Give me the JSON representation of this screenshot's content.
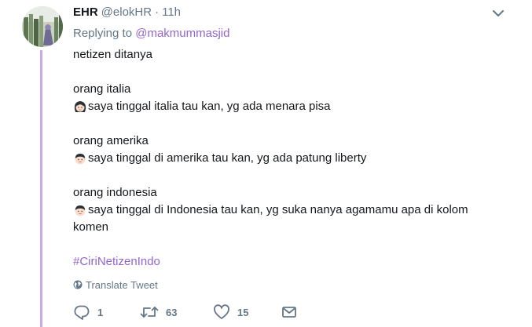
{
  "tweet": {
    "author_name": "EHR",
    "author_handle": "@elokHR",
    "separator": "·",
    "time": "11h",
    "replying_prefix": "Replying to",
    "replying_to": "@makmummasjid",
    "lines": {
      "l1": "netizen ditanya",
      "l2": "orang italia",
      "l3": "saya tinggal italia tau kan, yg ada menara pisa",
      "l4": "orang amerika",
      "l5": "saya tinggal di amerika tau kan, yg ada patung liberty",
      "l6": "orang indonesia",
      "l7": "saya tinggal di Indonesia tau kan, yg suka nanya agamamu apa di kolom",
      "l8": "komen"
    },
    "hashtag": "#CiriNetizenIndo",
    "emojis": [
      "woman-face-emoji",
      "boy-face-emoji",
      "boy-face-emoji"
    ],
    "translate_label": "Translate Tweet"
  },
  "actions": {
    "reply_count": "1",
    "retweet_count": "63",
    "like_count": "15"
  },
  "colors": {
    "accent": "#9266cc",
    "muted": "#657786",
    "text": "#14171a",
    "thread_line": "#c9a9ec"
  },
  "icons": [
    "chevron-down-icon",
    "globe-icon",
    "reply-icon",
    "retweet-icon",
    "heart-icon",
    "envelope-icon"
  ]
}
